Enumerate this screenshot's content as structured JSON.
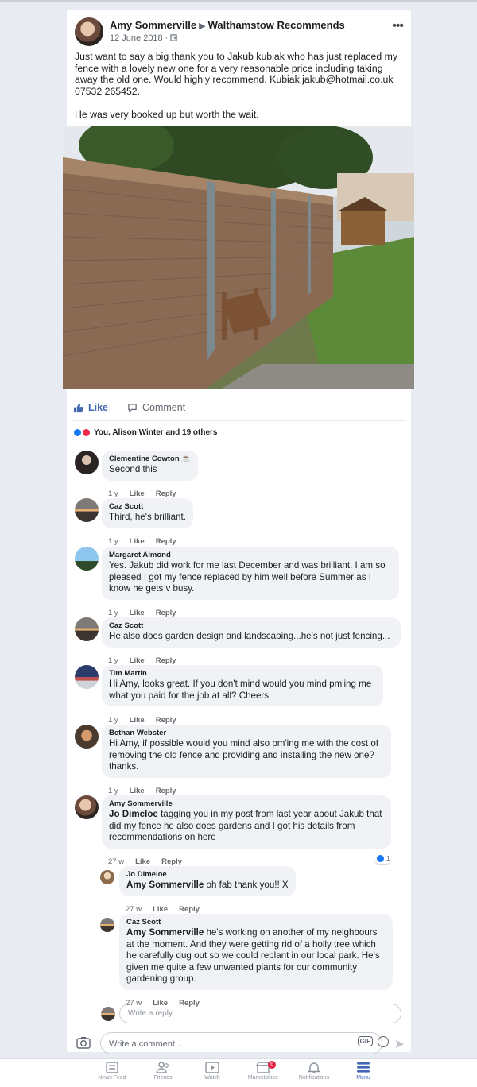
{
  "post": {
    "author": "Amy Sommerville",
    "group": "Walthamstow Recommends",
    "date": "12 June 2018",
    "text": "Just want to say a big thank you to Jakub kubiak who has just replaced my fence with a lovely new one for a very reasonable price including taking away the old one. Would highly recommend. Kubiak.jakub@hotmail.co.uk\n07532 265452.\n\nHe was very booked up but worth the wait.",
    "like_label": "Like",
    "comment_label": "Comment",
    "reactions_text": "You, Alison Winter and 19 others"
  },
  "comments": [
    {
      "name": "Clementine Cowton",
      "text": "Second this",
      "time": "1 y",
      "like": "Like",
      "reply": "Reply"
    },
    {
      "name": "Caz Scott",
      "text": "Third, he's brilliant.",
      "time": "1 y",
      "like": "Like",
      "reply": "Reply"
    },
    {
      "name": "Margaret Almond",
      "text": "Yes.  Jakub did work for me last December and was brilliant. I am so pleased I got my fence replaced by him well before Summer as I know he gets v busy.",
      "time": "1 y",
      "like": "Like",
      "reply": "Reply"
    },
    {
      "name": "Caz Scott",
      "text": "He also does garden design and landscaping...he's not just fencing...",
      "time": "1 y",
      "like": "Like",
      "reply": "Reply"
    },
    {
      "name": "Tim Martin",
      "text": "Hi Amy, looks great. If you don't mind would you mind pm'ing me what you paid for the job at all? Cheers",
      "time": "1 y",
      "like": "Like",
      "reply": "Reply"
    },
    {
      "name": "Bethan Webster",
      "text": "Hi Amy, if possible would you mind also pm'ing me with the cost of removing the old fence and providing and installing the new one? thanks.",
      "time": "1 y",
      "like": "Like",
      "reply": "Reply"
    },
    {
      "name": "Amy Sommerville",
      "tag": "Jo Dimeloe",
      "text": " tagging you in my post from last year about Jakub that did my fence he also does gardens and I got his details from recommendations on here",
      "time": "27 w",
      "like": "Like",
      "reply": "Reply",
      "like_count": "1"
    }
  ],
  "replies": [
    {
      "name": "Jo Dimeloe",
      "tag": "Amy Sommerville",
      "text": " oh fab thank you!! X",
      "time": "27 w",
      "like": "Like",
      "reply": "Reply"
    },
    {
      "name": "Caz Scott",
      "tag": "Amy Sommerville",
      "text": " he's working on another of my neighbours at the moment.  And they were getting rid of a holly tree which he carefully dug out so we could replant in our local park.  He's given me quite a few unwanted plants for our community gardening group.",
      "time": "27 w",
      "like": "Like",
      "reply": "Reply"
    }
  ],
  "reply_placeholder": "Write a reply...",
  "comment_placeholder": "Write a comment...",
  "gif_label": "GIF",
  "tabs": [
    {
      "label": "News Feed",
      "icon": "news-feed-icon"
    },
    {
      "label": "Friends",
      "icon": "friends-icon"
    },
    {
      "label": "Watch",
      "icon": "watch-icon"
    },
    {
      "label": "Marketplace",
      "icon": "marketplace-icon",
      "badge": "6"
    },
    {
      "label": "Notifications",
      "icon": "notifications-icon"
    },
    {
      "label": "Menu",
      "icon": "menu-icon",
      "active": true
    }
  ],
  "colors": {
    "brand": "#4267b2",
    "background": "#e9ebf2",
    "bubble": "#f0f2f5",
    "badge": "#e41e3f"
  }
}
